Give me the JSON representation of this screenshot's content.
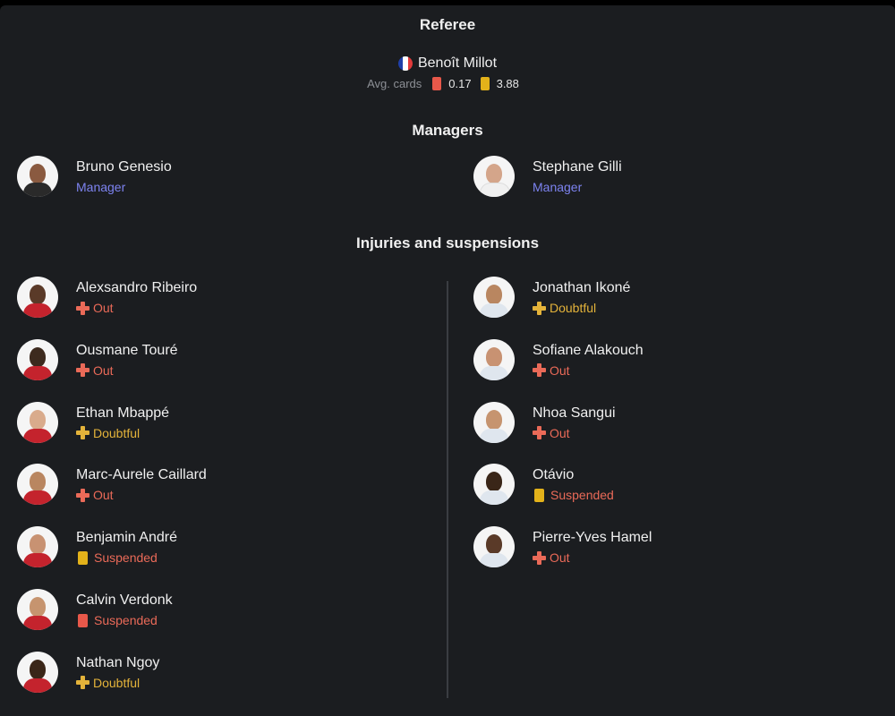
{
  "referee": {
    "title": "Referee",
    "name": "Benoît Millot",
    "avg_cards_label": "Avg. cards",
    "red_avg": "0.17",
    "yellow_avg": "3.88"
  },
  "managers": {
    "title": "Managers",
    "home": {
      "name": "Bruno Genesio",
      "role": "Manager"
    },
    "away": {
      "name": "Stephane Gilli",
      "role": "Manager"
    }
  },
  "injuries": {
    "title": "Injuries and suspensions",
    "home": [
      {
        "name": "Alexsandro Ribeiro",
        "status": "Out"
      },
      {
        "name": "Ousmane Touré",
        "status": "Out"
      },
      {
        "name": "Ethan Mbappé",
        "status": "Doubtful"
      },
      {
        "name": "Marc-Aurele Caillard",
        "status": "Out"
      },
      {
        "name": "Benjamin André",
        "status": "Suspended",
        "card": "yellow"
      },
      {
        "name": "Calvin Verdonk",
        "status": "Suspended",
        "card": "red"
      },
      {
        "name": "Nathan Ngoy",
        "status": "Doubtful"
      }
    ],
    "away": [
      {
        "name": "Jonathan Ikoné",
        "status": "Doubtful"
      },
      {
        "name": "Sofiane Alakouch",
        "status": "Out"
      },
      {
        "name": "Nhoa Sangui",
        "status": "Out"
      },
      {
        "name": "Otávio",
        "status": "Suspended",
        "card": "yellow"
      },
      {
        "name": "Pierre-Yves Hamel",
        "status": "Out"
      }
    ]
  },
  "colors": {
    "out": "#ea6a58",
    "doubtful": "#e4b33a",
    "red_card": "#e8584a",
    "yellow_card": "#e3b21a",
    "role": "#7d83f0"
  }
}
